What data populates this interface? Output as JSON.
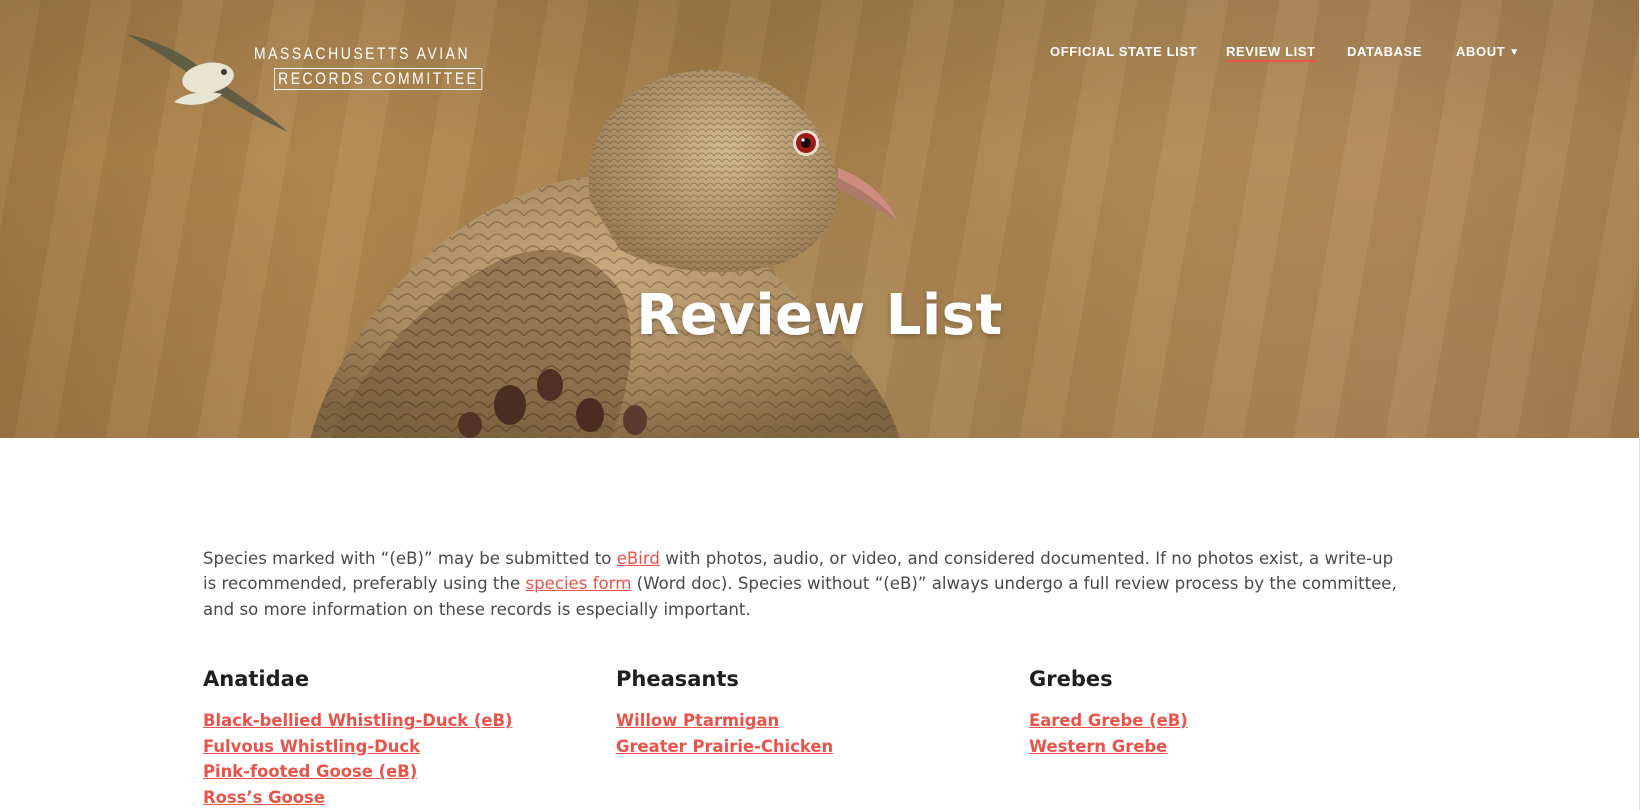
{
  "logo": {
    "line1": "MASSACHUSETTS AVIAN",
    "line2": "RECORDS COMMITTEE"
  },
  "nav": {
    "items": [
      {
        "label": "OFFICIAL STATE LIST",
        "active": false
      },
      {
        "label": "REVIEW LIST",
        "active": true
      },
      {
        "label": "DATABASE",
        "active": false
      },
      {
        "label": "ABOUT",
        "active": false,
        "icon": "chevron-down-icon"
      }
    ]
  },
  "hero": {
    "title": "Review List"
  },
  "intro": {
    "text1": "Species marked with “(eB)” may be submitted to ",
    "ebird_link": "eBird",
    "text2": " with photos, audio, or video, and considered documented. If no photos exist, a write-up is recommended, preferably using the ",
    "species_form_link": "species form",
    "text3": " (Word doc). Species without “(eB)” always undergo a full review process by the committee, and so more information on these records is especially important."
  },
  "sections": [
    {
      "heading": "Anatidae",
      "species": [
        "Black-bellied Whistling-Duck (eB)",
        "Fulvous Whistling-Duck",
        "Pink-footed Goose (eB)",
        "Ross’s Goose"
      ]
    },
    {
      "heading": "Pheasants",
      "species": [
        "Willow Ptarmigan",
        "Greater Prairie-Chicken"
      ]
    },
    {
      "heading": "Grebes",
      "species": [
        "Eared Grebe (eB)",
        "Western Grebe"
      ]
    }
  ],
  "colors": {
    "accent": "#e8544a",
    "body_text": "#4a4a4a",
    "heading": "#1f1f1f",
    "hero_brown": "#a98250"
  }
}
